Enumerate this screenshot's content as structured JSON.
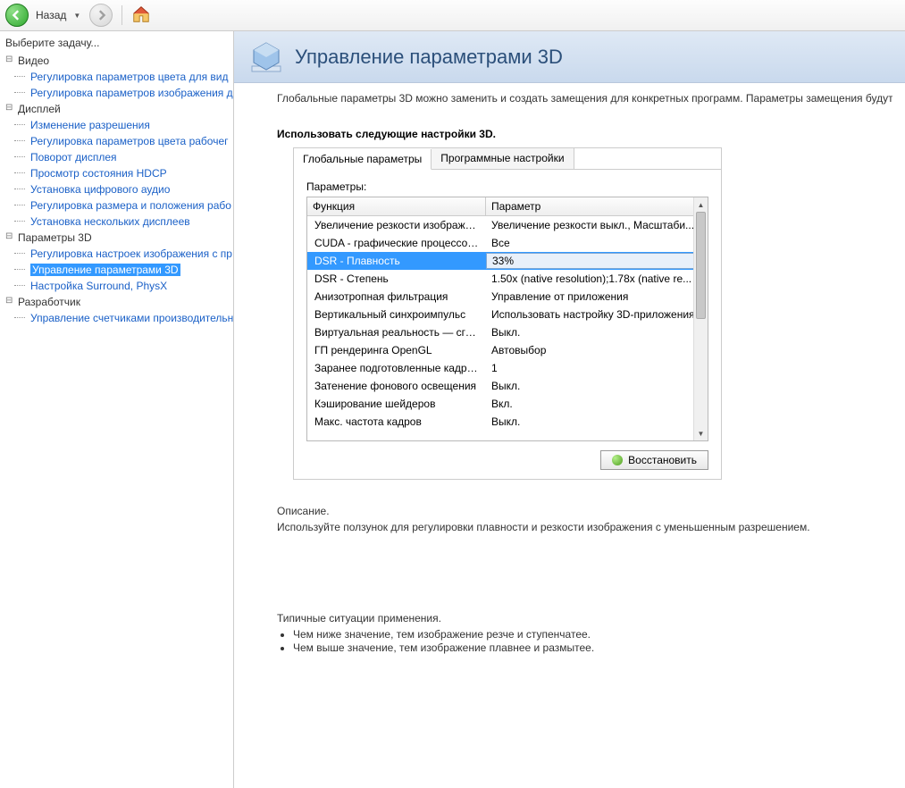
{
  "toolbar": {
    "back": "Назад"
  },
  "sidebar": {
    "title": "Выберите задачу...",
    "groups": [
      {
        "label": "Видео",
        "items": [
          "Регулировка параметров цвета для вид",
          "Регулировка параметров изображения д"
        ]
      },
      {
        "label": "Дисплей",
        "items": [
          "Изменение разрешения",
          "Регулировка параметров цвета рабочег",
          "Поворот дисплея",
          "Просмотр состояния HDCP",
          "Установка цифрового аудио",
          "Регулировка размера и положения рабо",
          "Установка нескольких дисплеев"
        ]
      },
      {
        "label": "Параметры 3D",
        "items": [
          "Регулировка настроек изображения с пр",
          "Управление параметрами 3D",
          "Настройка Surround, PhysX"
        ],
        "selectedIndex": 1
      },
      {
        "label": "Разработчик",
        "items": [
          "Управление счетчиками производительн"
        ]
      }
    ]
  },
  "header": {
    "title": "Управление параметрами 3D"
  },
  "intro": "Глобальные параметры 3D можно заменить и создать замещения для конкретных программ. Параметры замещения будут автоматич",
  "panel": {
    "title": "Использовать следующие настройки 3D.",
    "tabs": [
      "Глобальные параметры",
      "Программные настройки"
    ],
    "paramsLabel": "Параметры:",
    "columns": [
      "Функция",
      "Параметр"
    ],
    "rows": [
      {
        "f": "Увеличение резкости изображения",
        "v": "Увеличение резкости выкл., Масштаби..."
      },
      {
        "f": "CUDA - графические процессоры",
        "v": "Все"
      },
      {
        "f": "DSR - Плавность",
        "v": "33%",
        "selected": true
      },
      {
        "f": "DSR - Степень",
        "v": "1.50x (native resolution);1.78x (native re..."
      },
      {
        "f": "Анизотропная фильтрация",
        "v": "Управление от приложения"
      },
      {
        "f": "Вертикальный синхроимпульс",
        "v": "Использовать настройку 3D-приложения"
      },
      {
        "f": "Виртуальная реальность — сглаживан...",
        "v": "Выкл."
      },
      {
        "f": "ГП рендеринга OpenGL",
        "v": "Автовыбор"
      },
      {
        "f": "Заранее подготовленные кадры вирту...",
        "v": "1"
      },
      {
        "f": "Затенение фонового освещения",
        "v": "Выкл."
      },
      {
        "f": "Кэширование шейдеров",
        "v": "Вкл."
      },
      {
        "f": "Макс. частота кадров",
        "v": "Выкл."
      }
    ],
    "restore": "Восстановить"
  },
  "desc": {
    "title": "Описание.",
    "text": "Используйте ползунок для регулировки плавности и резкости изображения с уменьшенным разрешением."
  },
  "typical": {
    "title": "Типичные ситуации применения.",
    "items": [
      "Чем ниже значение, тем изображение резче и ступенчатее.",
      "Чем выше значение, тем изображение плавнее и размытее."
    ]
  }
}
